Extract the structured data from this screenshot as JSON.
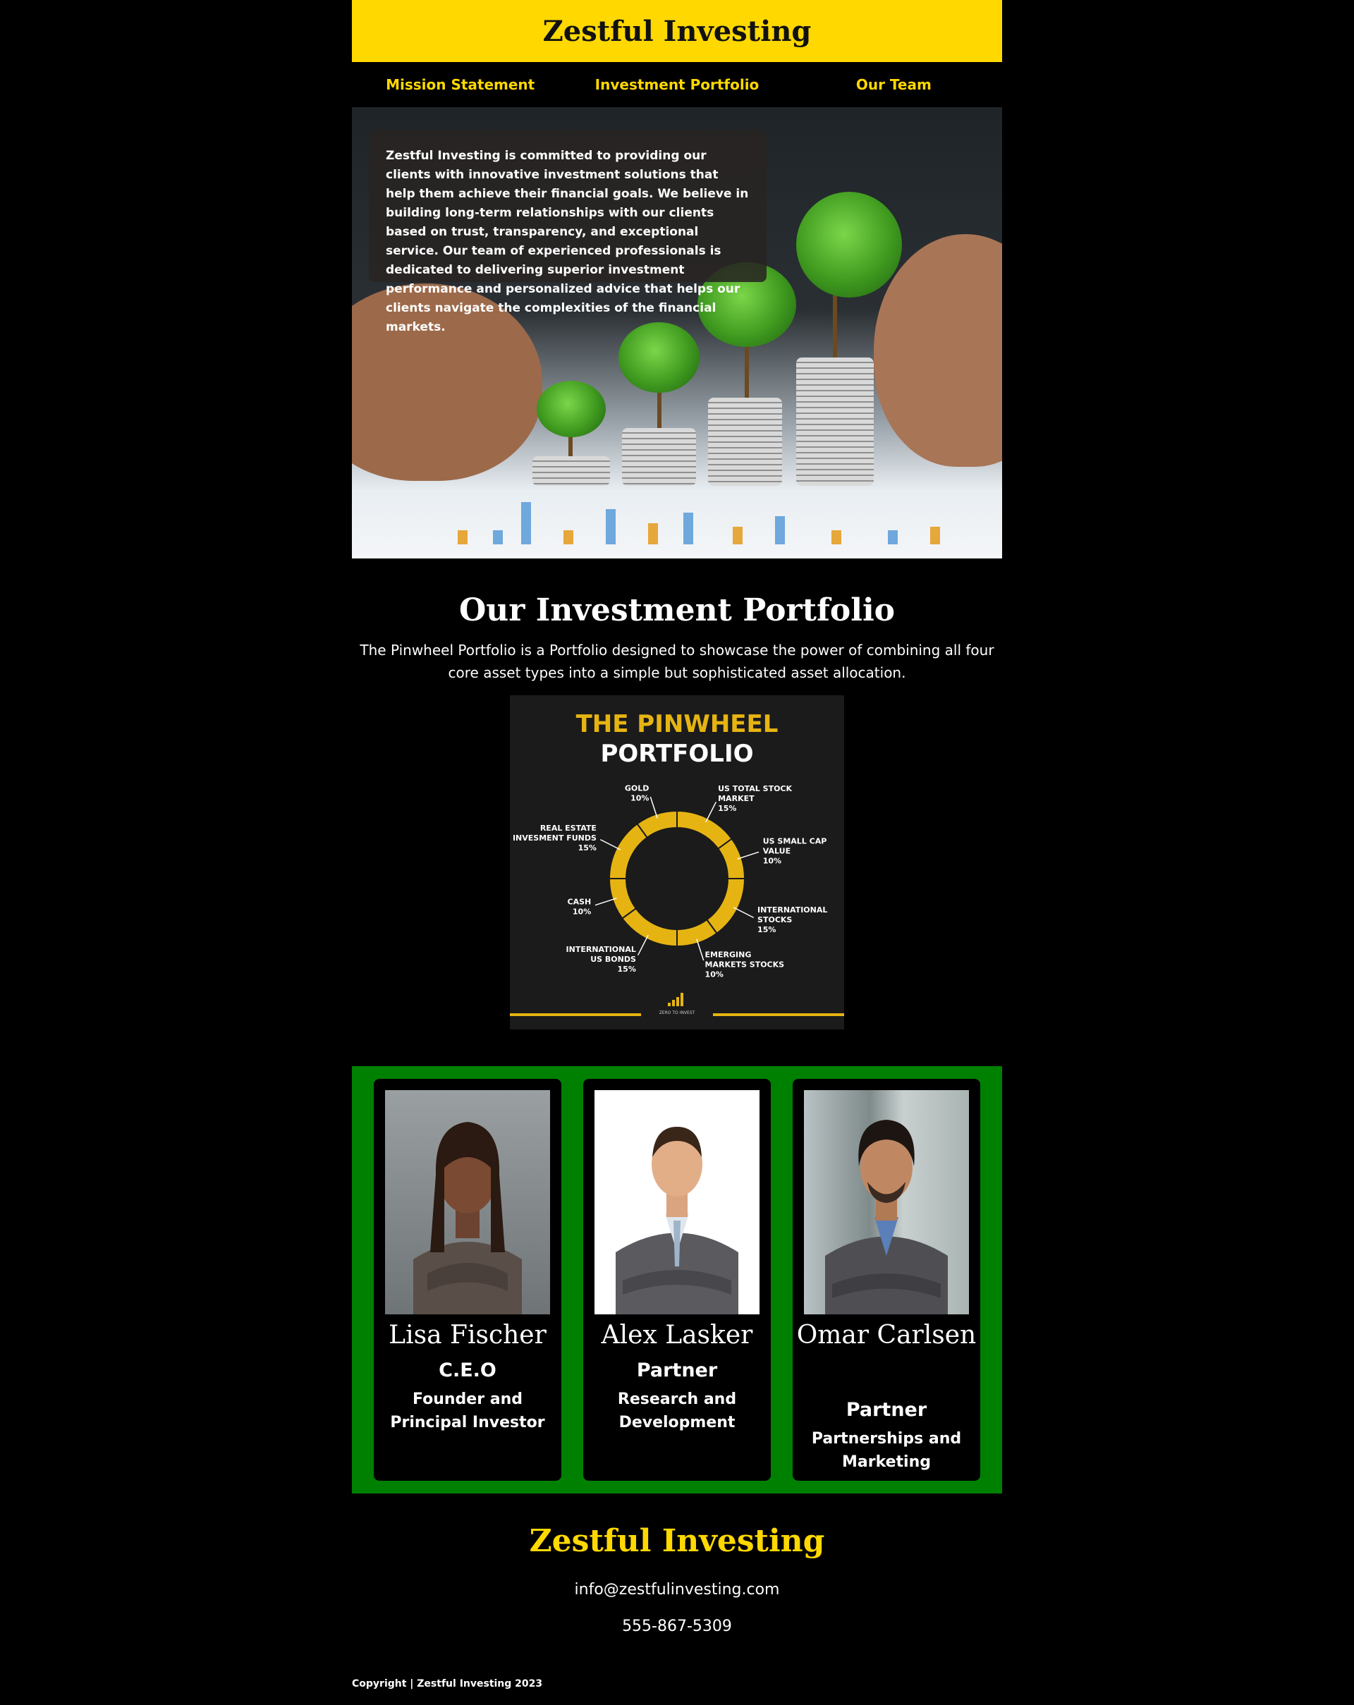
{
  "header": {
    "title": "Zestful Investing"
  },
  "nav": [
    {
      "label": "Mission Statement"
    },
    {
      "label": "Investment Portfolio"
    },
    {
      "label": "Our Team"
    }
  ],
  "hero": {
    "mission_text": "Zestful Investing is committed to providing our clients with innovative investment solutions that help them achieve their financial goals. We believe in building long-term relationships with our clients based on trust, transparency, and exceptional service. Our team of experienced professionals is dedicated to delivering superior investment performance and personalized advice that helps our clients navigate the complexities of the financial markets."
  },
  "portfolio": {
    "title": "Our Investment Portfolio",
    "description": "The Pinwheel Portfolio is a Portfolio designed to showcase the power of combining all four core asset types into a simple but sophisticated asset allocation.",
    "image": {
      "title_line1": "THE PINWHEEL",
      "title_line2": "PORTFOLIO",
      "logo_text": "ZERO TO INVEST",
      "accent": "#E6B412",
      "slices": [
        {
          "label_lines": [
            "US TOTAL STOCK",
            "MARKET",
            "15%"
          ],
          "value": 15
        },
        {
          "label_lines": [
            "US SMALL CAP",
            "VALUE",
            "10%"
          ],
          "value": 10
        },
        {
          "label_lines": [
            "INTERNATIONAL",
            "STOCKS",
            "15%"
          ],
          "value": 15
        },
        {
          "label_lines": [
            "EMERGING",
            "MARKETS STOCKS",
            "10%"
          ],
          "value": 10
        },
        {
          "label_lines": [
            "INTERNATIONAL",
            "US BONDS",
            "15%"
          ],
          "value": 15
        },
        {
          "label_lines": [
            "CASH",
            "10%"
          ],
          "value": 10
        },
        {
          "label_lines": [
            "REAL ESTATE",
            "INVESMENT FUNDS",
            "15%"
          ],
          "value": 15
        },
        {
          "label_lines": [
            "GOLD",
            "10%"
          ],
          "value": 10
        }
      ]
    }
  },
  "team": [
    {
      "name": "Lisa Fischer",
      "role": "C.E.O",
      "desc": "Founder and Principal Investor"
    },
    {
      "name": "Alex Lasker",
      "role": "Partner",
      "desc": "Research and Development"
    },
    {
      "name": "Omar Carlsen",
      "role": "Partner",
      "desc": "Partnerships and Marketing"
    }
  ],
  "footer": {
    "title": "Zestful Investing",
    "email": "info@zestfulinvesting.com",
    "phone": "555-867-5309",
    "copyright": "Copyright | Zestful Investing 2023"
  },
  "colors": {
    "brand_yellow": "#FFD800",
    "team_green": "#008000",
    "background": "#000000"
  }
}
